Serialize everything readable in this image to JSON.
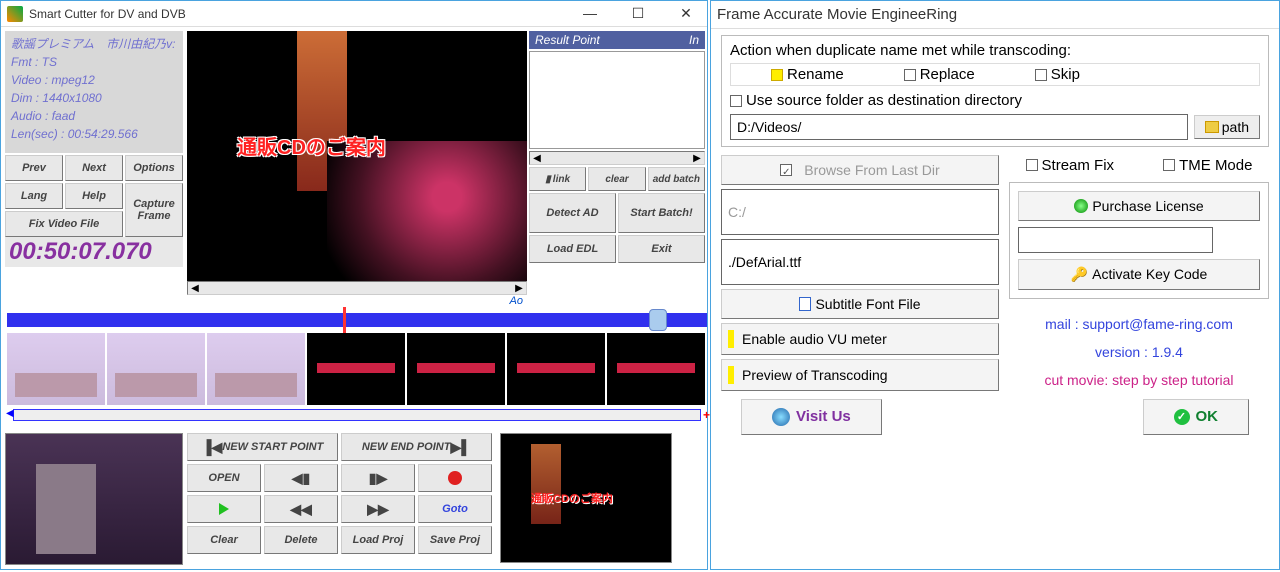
{
  "left": {
    "title": "Smart Cutter for DV and DVB",
    "info": {
      "line1": "歌謡プレミアム　市川由紀乃v:",
      "fmt": "Fmt : TS",
      "video": "Video : mpeg12",
      "dim": "Dim : 1440x1080",
      "audio": "Audio : faad",
      "len": "Len(sec) : 00:54:29.566"
    },
    "buttons": {
      "prev": "Prev",
      "next": "Next",
      "options": "Options",
      "lang": "Lang",
      "help": "Help",
      "capture": "Capture Frame",
      "fixvideo": "Fix Video File"
    },
    "overlay_text": "通販CDのご案内",
    "result_header": "Result Point",
    "result_in": "In",
    "link": "link",
    "clear": "clear",
    "addbatch": "add batch",
    "detectad": "Detect AD",
    "startbatch": "Start Batch!",
    "loadedl": "Load EDL",
    "exit": "Exit",
    "timecode": "00:50:07.070",
    "ao": "Ao",
    "newstart": "NEW START POINT",
    "newend": "NEW END POINT",
    "open": "OPEN",
    "goto": "Goto",
    "clear2": "Clear",
    "delete": "Delete",
    "loadproj": "Load Proj",
    "saveproj": "Save Proj",
    "result_text": "通販CDのご案内"
  },
  "right": {
    "title": "Frame Accurate Movie EngineeRing",
    "action_label": "Action when duplicate name met while transcoding:",
    "rename": "Rename",
    "replace": "Replace",
    "skip": "Skip",
    "use_source": "Use source folder as destination directory",
    "dest_path": "D:/Videos/",
    "path_btn": "path",
    "browse_last": "Browse From Last Dir",
    "c_path": "C:/",
    "font_path": "./DefArial.ttf",
    "subtitle_btn": "Subtitle Font File",
    "enable_vu": "Enable audio VU meter",
    "preview_trans": "Preview of Transcoding",
    "stream_fix": "Stream Fix",
    "tme_mode": "TME Mode",
    "purchase": "Purchase License",
    "activate": "Activate Key Code",
    "mail": "mail : support@fame-ring.com",
    "version": "version : 1.9.4",
    "tutorial": "cut movie: step by step tutorial",
    "visit": "Visit Us",
    "ok": "OK"
  }
}
